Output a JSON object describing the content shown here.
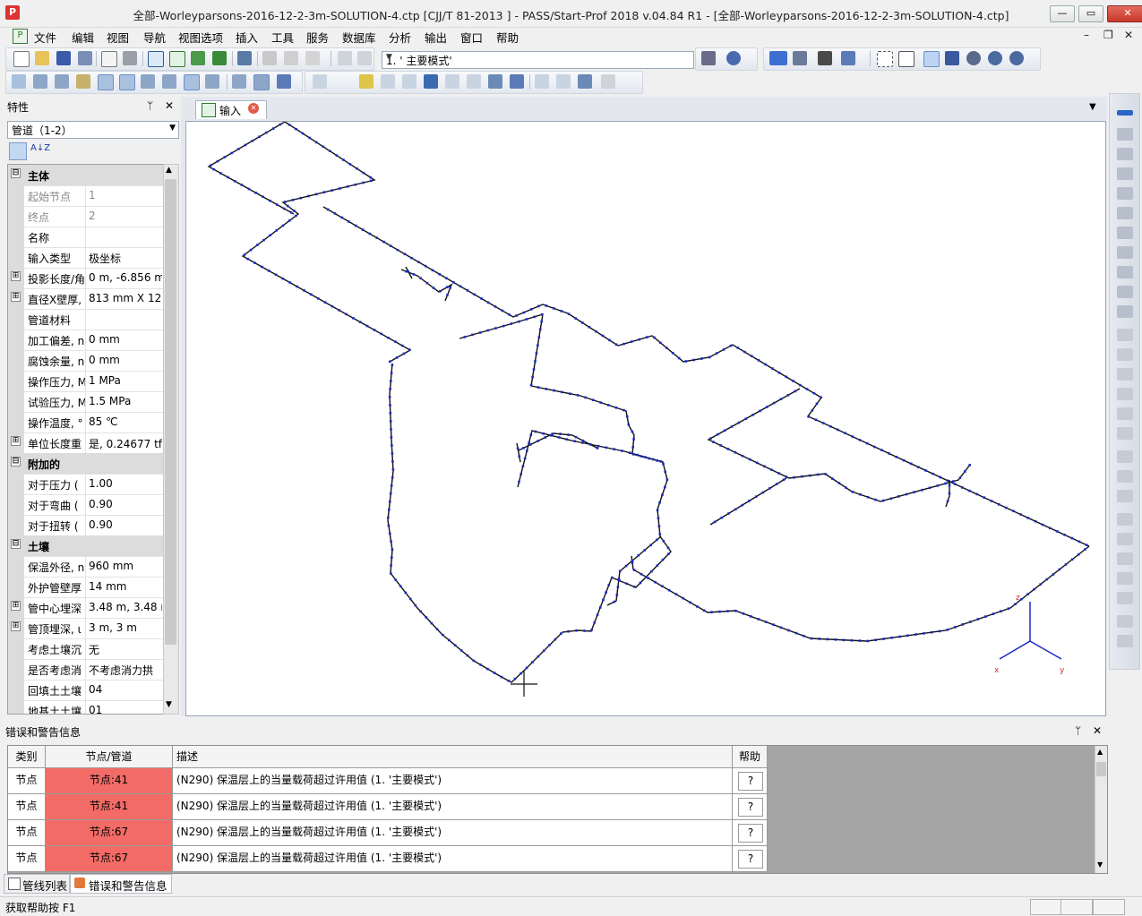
{
  "window": {
    "title": "全部-Worleyparsons-2016-12-2-3m-SOLUTION-4.ctp [CJJ/T 81-2013 ] - PASS/Start-Prof 2018 v.04.84 R1 - [全部-Worleyparsons-2016-12-2-3m-SOLUTION-4.ctp]",
    "minimize": "—",
    "maximize": "▭",
    "close": "✕"
  },
  "menu": [
    "文件",
    "编辑",
    "视图",
    "导航",
    "视图选项",
    "插入",
    "工具",
    "服务",
    "数据库",
    "分析",
    "输出",
    "窗口",
    "帮助"
  ],
  "mdi_controls": {
    "minimize": "–",
    "restore": "❐",
    "close": "✕"
  },
  "toolbar": {
    "mode_value": "1. ' 主要模式'"
  },
  "properties": {
    "title": "特性",
    "pin": "ᛘ",
    "close": "✕",
    "combo_value": "管道（1-2）",
    "sort_label": "A↓Z",
    "rows": [
      {
        "kind": "cat",
        "expander": "⊟",
        "name": "主体",
        "value": ""
      },
      {
        "kind": "dis",
        "expander": "",
        "name": "起始节点",
        "value": "1"
      },
      {
        "kind": "dis",
        "expander": "",
        "name": "终点",
        "value": "2"
      },
      {
        "kind": "prop",
        "expander": "",
        "name": "名称",
        "value": ""
      },
      {
        "kind": "prop",
        "expander": "",
        "name": "输入类型",
        "value": "极坐标"
      },
      {
        "kind": "prop",
        "expander": "⊞",
        "name": "投影长度/角",
        "value": "0 m, -6.856 m"
      },
      {
        "kind": "prop",
        "expander": "⊞",
        "name": "直径X壁厚,",
        "value": "813 mm X 12."
      },
      {
        "kind": "prop",
        "expander": "",
        "name": "管道材料",
        "value": ""
      },
      {
        "kind": "prop",
        "expander": "",
        "name": "加工偏差, n",
        "value": "0 mm"
      },
      {
        "kind": "prop",
        "expander": "",
        "name": "腐蚀余量, n",
        "value": "0 mm"
      },
      {
        "kind": "prop",
        "expander": "",
        "name": "操作压力, M",
        "value": "1 MPa"
      },
      {
        "kind": "prop",
        "expander": "",
        "name": "试验压力, M",
        "value": "1.5 MPa"
      },
      {
        "kind": "prop",
        "expander": "",
        "name": "操作温度, °",
        "value": "85 ℃"
      },
      {
        "kind": "prop",
        "expander": "⊞",
        "name": "单位长度重",
        "value": "是, 0.24677 tf/"
      },
      {
        "kind": "cat",
        "expander": "⊟",
        "name": "附加的",
        "value": ""
      },
      {
        "kind": "prop",
        "expander": "",
        "name": "对于压力 (",
        "value": "1.00"
      },
      {
        "kind": "prop",
        "expander": "",
        "name": "对于弯曲 (",
        "value": "0.90"
      },
      {
        "kind": "prop",
        "expander": "",
        "name": "对于扭转 (",
        "value": "0.90"
      },
      {
        "kind": "cat",
        "expander": "⊟",
        "name": "土壤",
        "value": ""
      },
      {
        "kind": "prop",
        "expander": "",
        "name": "保温外径, n",
        "value": "960 mm"
      },
      {
        "kind": "prop",
        "expander": "",
        "name": "外护管壁厚",
        "value": "14 mm"
      },
      {
        "kind": "prop",
        "expander": "⊞",
        "name": "管中心埋深",
        "value": "3.48 m, 3.48 n"
      },
      {
        "kind": "prop",
        "expander": "⊞",
        "name": "管顶埋深, ι",
        "value": "3 m, 3 m"
      },
      {
        "kind": "prop",
        "expander": "",
        "name": "考虑土壤沉",
        "value": "无"
      },
      {
        "kind": "prop",
        "expander": "",
        "name": "是否考虑消",
        "value": "不考虑消力拱"
      },
      {
        "kind": "prop",
        "expander": "",
        "name": "回填土土壤",
        "value": "04"
      },
      {
        "kind": "prop",
        "expander": "",
        "name": "地基土土壤",
        "value": "01"
      }
    ]
  },
  "document": {
    "tab_label": "输入",
    "tab_close": "✕",
    "menu_arrow": "▼",
    "axis_labels": {
      "z": "z",
      "x": "x",
      "y": "y"
    }
  },
  "errors": {
    "title": "错误和警告信息",
    "pin": "ᛘ",
    "close": "✕",
    "headers": [
      "类别",
      "节点/管道",
      "描述",
      "帮助"
    ],
    "rows": [
      {
        "type": "节点",
        "node": "节点:41",
        "desc": "(N290) 保温层上的当量载荷超过许用值 (1. '主要模式')",
        "help": "?"
      },
      {
        "type": "节点",
        "node": "节点:41",
        "desc": "(N290) 保温层上的当量载荷超过许用值 (1. '主要模式')",
        "help": "?"
      },
      {
        "type": "节点",
        "node": "节点:67",
        "desc": "(N290) 保温层上的当量载荷超过许用值 (1. '主要模式')",
        "help": "?"
      },
      {
        "type": "节点",
        "node": "节点:67",
        "desc": "(N290) 保温层上的当量载荷超过许用值 (1. '主要模式')",
        "help": "?"
      }
    ]
  },
  "bottom_tabs": [
    "管线列表",
    "错误和警告信息"
  ],
  "status": {
    "text": "获取帮助按 F1"
  },
  "colors": {
    "pipe": "#111111",
    "support": "#1a2bbf",
    "axis": "#1a2bbf",
    "error_cell": "#f26b66"
  }
}
